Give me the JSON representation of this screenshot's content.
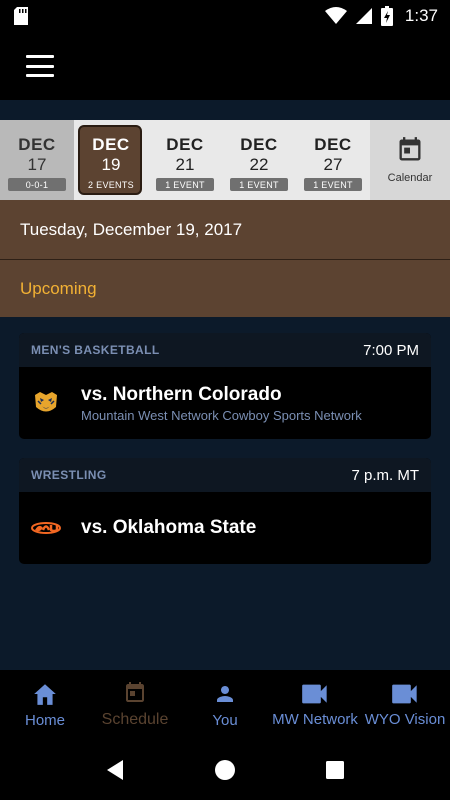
{
  "status_bar": {
    "time": "1:37"
  },
  "date_strip": {
    "dates": [
      {
        "month": "DEC",
        "day": "17",
        "badge": "0-0-1"
      },
      {
        "month": "DEC",
        "day": "19",
        "badge": "2 EVENTS"
      },
      {
        "month": "DEC",
        "day": "21",
        "badge": "1 EVENT"
      },
      {
        "month": "DEC",
        "day": "22",
        "badge": "1 EVENT"
      },
      {
        "month": "DEC",
        "day": "27",
        "badge": "1 EVENT"
      }
    ],
    "calendar_label": "Calendar"
  },
  "date_header": "Tuesday, December 19, 2017",
  "section_header": "Upcoming",
  "events": [
    {
      "sport": "MEN'S BASKETBALL",
      "time": "7:00 PM",
      "opponent": "vs. Northern Colorado",
      "network": "Mountain West Network Cowboy Sports Network"
    },
    {
      "sport": "WRESTLING",
      "time": "7 p.m. MT",
      "opponent": "vs. Oklahoma State",
      "network": ""
    }
  ],
  "bottom_nav": [
    {
      "label": "Home",
      "icon": "home-icon"
    },
    {
      "label": "Schedule",
      "icon": "calendar-icon"
    },
    {
      "label": "You",
      "icon": "person-icon"
    },
    {
      "label": "MW Network",
      "icon": "video-icon"
    },
    {
      "label": "WYO Vision",
      "icon": "video-icon"
    }
  ],
  "colors": {
    "accent_brown": "#5c4331",
    "upcoming_gold": "#f2b134",
    "nav_blue": "#6a8ed6"
  }
}
